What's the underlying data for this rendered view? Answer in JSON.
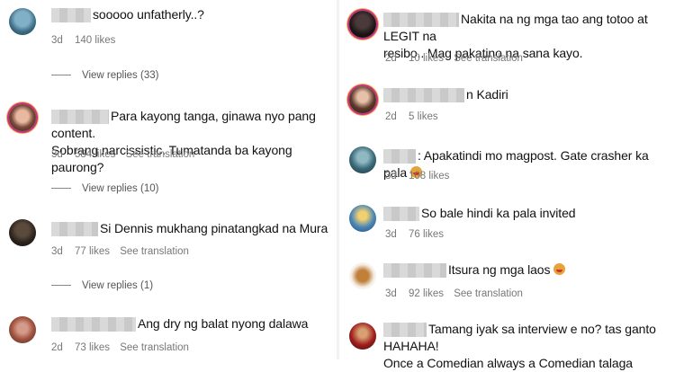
{
  "left_comments": [
    {
      "text": "sooooo unfatherly..?",
      "age": "3d",
      "likes": "140 likes",
      "translation": "",
      "replies": "View replies (33)"
    },
    {
      "text_lines": [
        "Para kayong tanga, ginawa nyo pang content.",
        "Sobrang narcissistic. Tumatanda ba kayong paurong?"
      ],
      "age": "3d",
      "likes": "584 likes",
      "translation": "See translation",
      "replies": "View replies (10)"
    },
    {
      "text": "Si Dennis mukhang pinatangkad na Mura",
      "age": "3d",
      "likes": "77 likes",
      "translation": "See translation",
      "replies": "View replies (1)"
    },
    {
      "text": "Ang dry ng balat nyong dalawa",
      "age": "2d",
      "likes": "73 likes",
      "translation": "See translation",
      "replies": ""
    }
  ],
  "right_comments": [
    {
      "text_lines": [
        "Nakita na ng mga tao ang totoo at LEGIT na",
        "resibo.. Mag pakatino na sana kayo."
      ],
      "age": "2d",
      "likes": "10 likes",
      "translation": "See translation"
    },
    {
      "text": "n Kadiri",
      "age": "2d",
      "likes": "5 likes",
      "translation": ""
    },
    {
      "text": ": Apakatindi mo magpost. Gate crasher ka pala",
      "age": "3d",
      "likes": "108 likes",
      "translation": ""
    },
    {
      "text": "So bale hindi ka pala invited",
      "age": "3d",
      "likes": "76 likes",
      "translation": ""
    },
    {
      "text": "Itsura ng mga laos",
      "age": "3d",
      "likes": "92 likes",
      "translation": "See translation"
    },
    {
      "text_lines": [
        "Tamang iyak sa interview e no? tas ganto HAHAHA!",
        "Once a Comedian always a Comedian talaga"
      ],
      "age": "",
      "likes": "",
      "translation": ""
    }
  ],
  "icons": {
    "emoji": "laughing-face-emoji",
    "avatar": "user-avatar"
  },
  "colors": {
    "text": "#111111",
    "meta": "#777777",
    "story_ring": "#c13584"
  }
}
